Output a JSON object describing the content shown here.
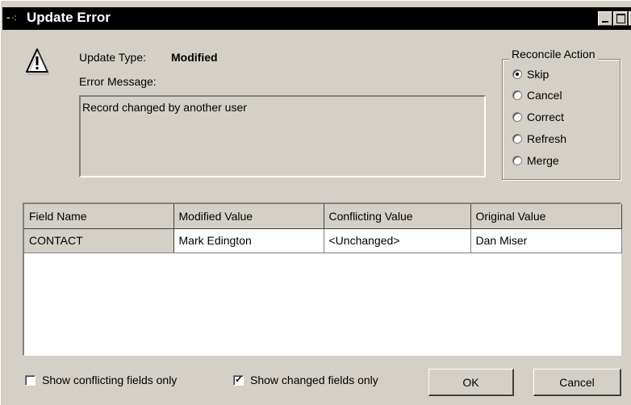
{
  "window": {
    "title": "Update Error"
  },
  "update_type": {
    "label": "Update Type:",
    "value": "Modified"
  },
  "error_message": {
    "label": "Error Message:",
    "text": "Record changed by another user"
  },
  "reconcile": {
    "title": "Reconcile Action",
    "options": [
      {
        "label": "Skip",
        "selected": true
      },
      {
        "label": "Cancel",
        "selected": false
      },
      {
        "label": "Correct",
        "selected": false
      },
      {
        "label": "Refresh",
        "selected": false
      },
      {
        "label": "Merge",
        "selected": false
      }
    ]
  },
  "grid": {
    "columns": [
      "Field Name",
      "Modified Value",
      "Conflicting Value",
      "Original Value"
    ],
    "rows": [
      [
        "CONTACT",
        "Mark Edington",
        "<Unchanged>",
        "Dan Miser"
      ]
    ]
  },
  "options": {
    "conflicting_only": {
      "label": "Show conflicting fields only",
      "checked": false
    },
    "changed_only": {
      "label": "Show changed fields only",
      "checked": true
    }
  },
  "buttons": {
    "ok": "OK",
    "cancel": "Cancel"
  }
}
